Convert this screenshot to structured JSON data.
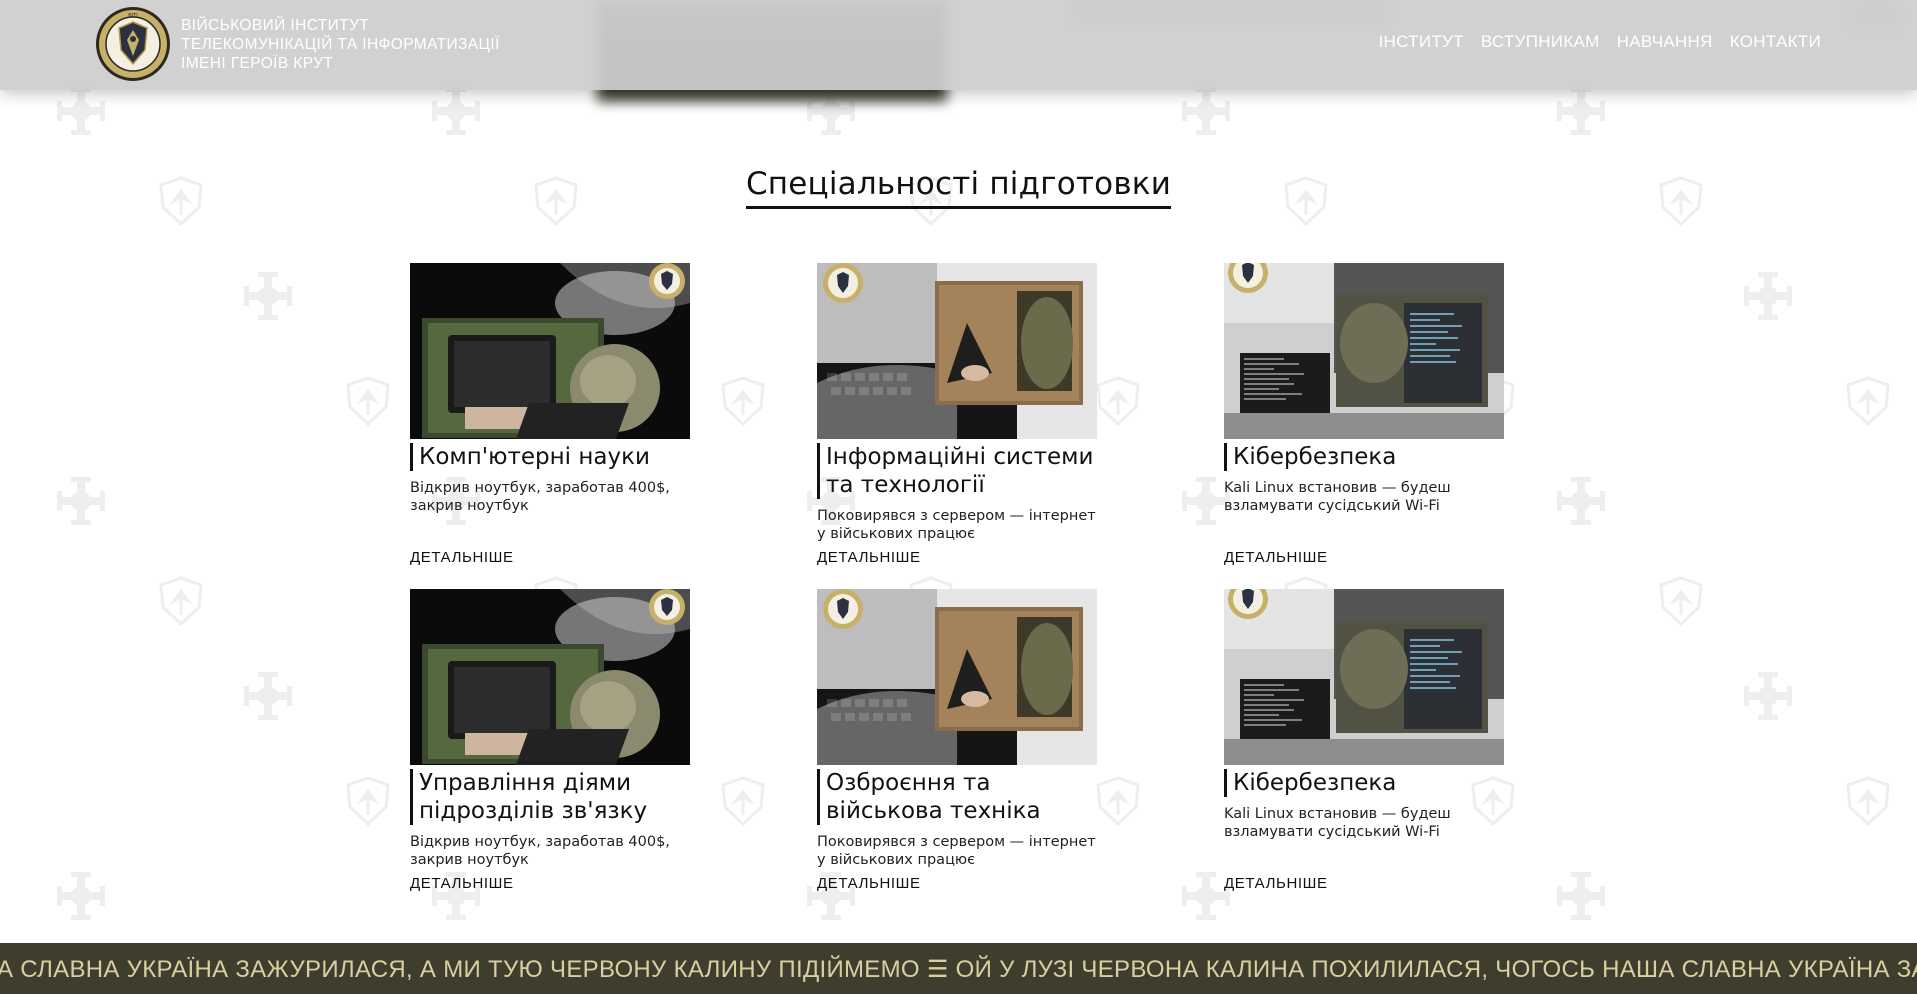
{
  "header": {
    "brand_lines": [
      "ВІЙСЬКОВИЙ ІНСТИТУТ",
      "ТЕЛЕКОМУНІКАЦІЙ ТА ІНФОРМАТИЗАЦІЇ",
      "ІМЕНІ ГЕРОЇВ КРУТ"
    ],
    "nav": [
      "ІНСТИТУТ",
      "ВСТУПНИКАМ",
      "НАВЧАННЯ",
      "КОНТАКТИ"
    ]
  },
  "section": {
    "title": "Спеціальності підготовки"
  },
  "specialties": [
    {
      "name": "Комп'ютерні науки",
      "desc": "Відкрив ноутбук, заработав 400$, закрив ноутбук",
      "more": "ДЕТАЛЬНІШЕ",
      "image": "laptop-field-photo"
    },
    {
      "name": "Інформаційні системи та технології",
      "desc": "Поковирявся з сервером — інтернет у військових працює",
      "more": "ДЕТАЛЬНІШЕ",
      "image": "server-room-photo"
    },
    {
      "name": "Кібербезпека",
      "desc": "Kali Linux встановив — будеш взламувати сусідський Wi-Fi",
      "more": "ДЕТАЛЬНІШЕ",
      "image": "cyber-monitors-photo"
    },
    {
      "name": "Управління діями підрозділів зв'язку",
      "desc": "Відкрив ноутбук, заработав 400$, закрив ноутбук",
      "more": "ДЕТАЛЬНІШЕ",
      "image": "laptop-field-photo"
    },
    {
      "name": "Озброєння та військова техніка",
      "desc": "Поковирявся з сервером — інтернет у військових працює",
      "more": "ДЕТАЛЬНІШЕ",
      "image": "server-room-photo"
    },
    {
      "name": "Кібербезпека",
      "desc": "Kali Linux встановив — будеш взламувати сусідський Wi-Fi",
      "more": "ДЕТАЛЬНІШЕ",
      "image": "cyber-monitors-photo"
    }
  ],
  "marquee": {
    "text": "А СЛАВНА УКРАЇНА ЗАЖУРИЛАСЯ, А МИ ТУЮ ЧЕРВОНУ КАЛИНУ ПІДІЙМЕМО ☰ ОЙ У ЛУЗІ ЧЕРВОНА КАЛИНА ПОХИЛИЛАСЯ, ЧОГОСЬ НАША СЛАВНА УКРАЇНА ЗАЖУРИЛАСЯ"
  },
  "icons": {
    "logo": "institute-emblem-icon",
    "watermark_a": "cross-emblem-icon",
    "watermark_b": "shield-eagle-icon"
  },
  "colors": {
    "header_bg": "#cdcdcd",
    "marquee_bg": "#3f3d2e",
    "marquee_text": "#d9cfa0",
    "text": "#111111"
  }
}
